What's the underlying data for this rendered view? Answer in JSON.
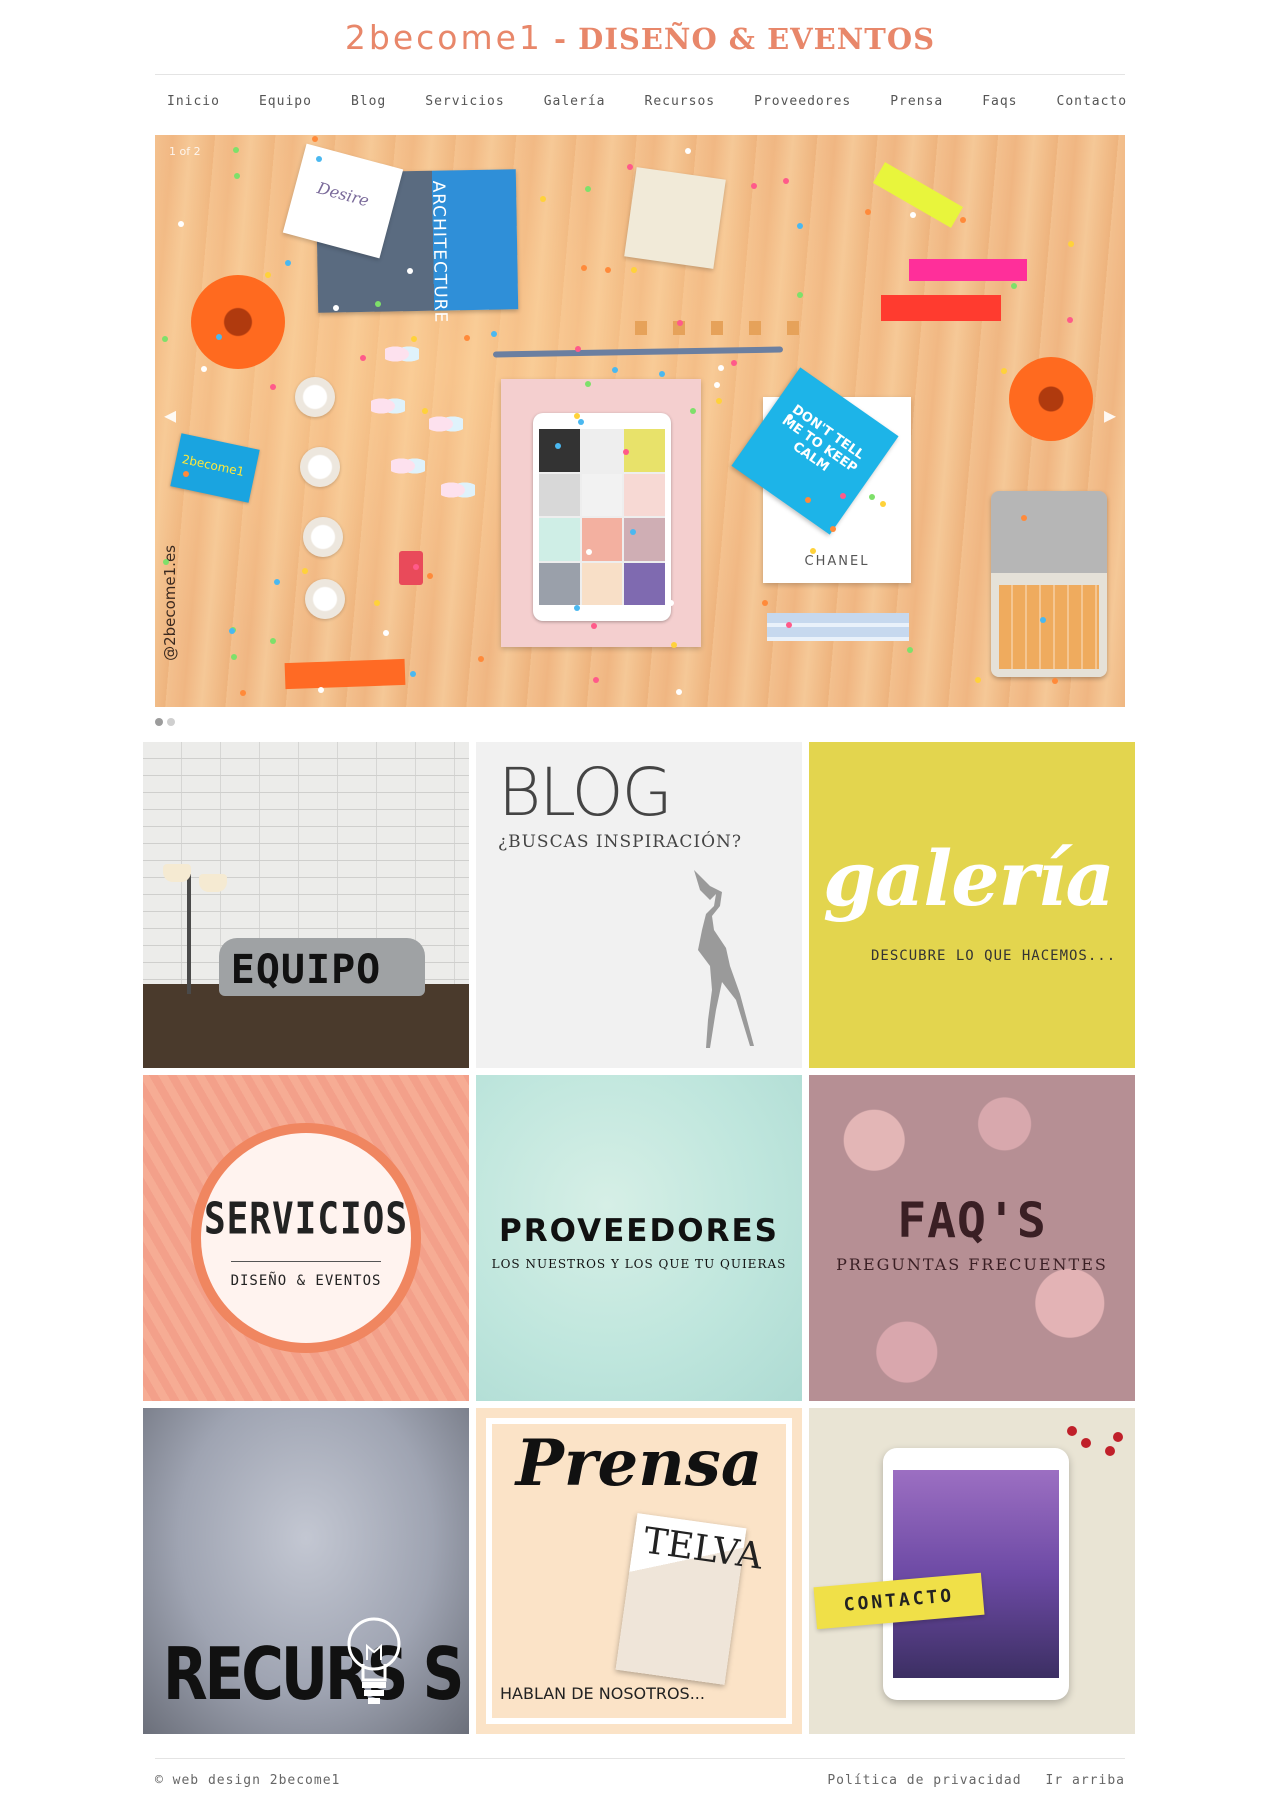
{
  "header": {
    "brand": "2become1",
    "separator": " - ",
    "tagline": "DISEÑO & EVENTOS"
  },
  "nav": {
    "items": [
      "Inicio",
      "Equipo",
      "Blog",
      "Servicios",
      "Galería",
      "Recursos",
      "Proveedores",
      "Prensa",
      "Faqs",
      "Contacto"
    ]
  },
  "slider": {
    "counter": "1 of 2",
    "prev_icon": "chevron-left-icon",
    "next_icon": "chevron-right-icon",
    "total_slides": 2,
    "active_slide": 1,
    "photo": {
      "card_text": "Desire",
      "book_spine": "ARCHITECTURE",
      "keep_calm": "DON'T TELL ME TO KEEP CALM",
      "box_brand": "CHANEL",
      "biz_card": "2become1",
      "watermark": "@2become1.es"
    }
  },
  "tiles": {
    "equipo": {
      "label": "EQUIPO"
    },
    "blog": {
      "title": "BLOG",
      "subtitle": "¿BUSCAS INSPIRACIÓN?"
    },
    "galeria": {
      "title": "galería",
      "subtitle": "DESCUBRE LO QUE HACEMOS..."
    },
    "servicios": {
      "title": "SERVICIOS",
      "subtitle": "DISEÑO & EVENTOS"
    },
    "proveedores": {
      "title": "PROVEEDORES",
      "subtitle": "LOS NUESTROS Y LOS QUE TU QUIERAS"
    },
    "faqs": {
      "title": "FAQ'S",
      "subtitle": "PREGUNTAS FRECUENTES"
    },
    "recursos": {
      "title": "RECURS S"
    },
    "prensa": {
      "title": "Prensa",
      "magazine": "TELVA",
      "subtitle": "HABLAN DE NOSOTROS..."
    },
    "contacto": {
      "label": "CONTACTO"
    }
  },
  "footer": {
    "copyright": "© web design 2become1",
    "links": [
      "Política de privacidad",
      "Ir arriba"
    ]
  },
  "colors": {
    "brand": "#e8876a",
    "galeria_bg": "#e3d54e",
    "servicios_ring": "#f08660",
    "proveedores_bg": "#bfe6dd",
    "contacto_banner": "#f0e048"
  }
}
